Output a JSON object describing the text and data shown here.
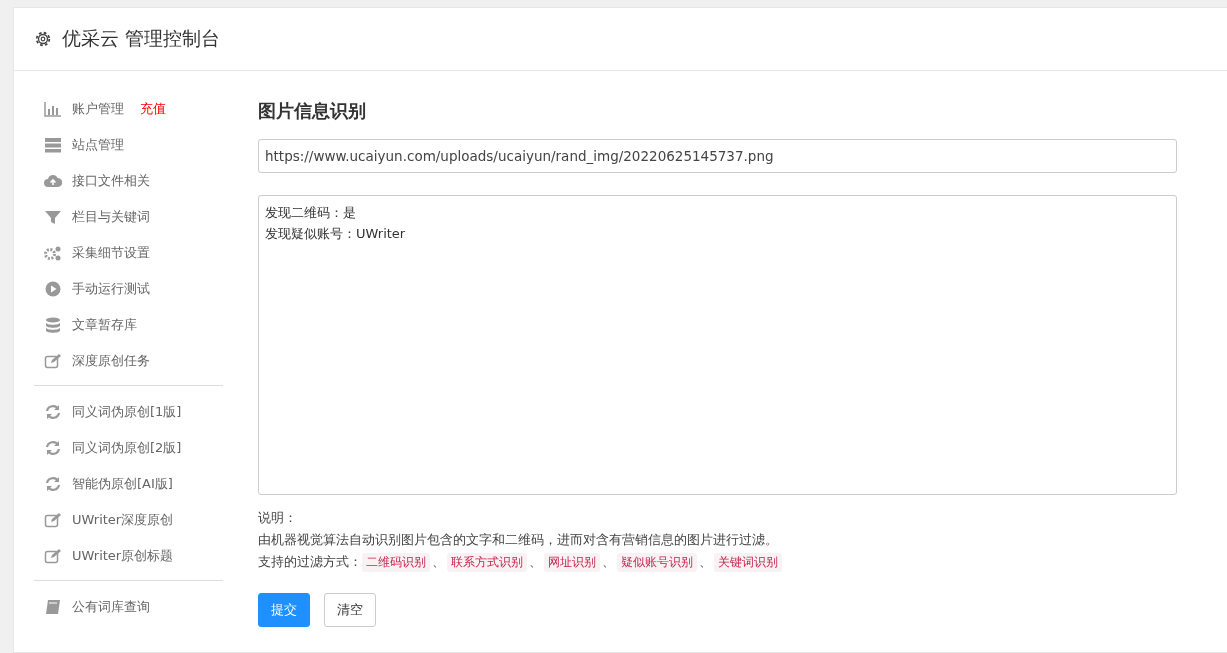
{
  "header": {
    "title": "优采云 管理控制台"
  },
  "sidebar": {
    "groups": [
      {
        "items": [
          {
            "label": "账户管理",
            "badge": "充值"
          },
          {
            "label": "站点管理"
          },
          {
            "label": "接口文件相关"
          },
          {
            "label": "栏目与关键词"
          },
          {
            "label": "采集细节设置"
          },
          {
            "label": "手动运行测试"
          },
          {
            "label": "文章暂存库"
          },
          {
            "label": "深度原创任务"
          }
        ]
      },
      {
        "items": [
          {
            "label": "同义词伪原创[1版]"
          },
          {
            "label": "同义词伪原创[2版]"
          },
          {
            "label": "智能伪原创[AI版]"
          },
          {
            "label": "UWriter深度原创"
          },
          {
            "label": "UWriter原创标题"
          }
        ]
      },
      {
        "items": [
          {
            "label": "公有词库查询"
          }
        ]
      }
    ]
  },
  "main": {
    "title": "图片信息识别",
    "url_field": {
      "value": "https://www.ucaiyun.com/uploads/ucaiyun/rand_img/20220625145737.png"
    },
    "result_box": {
      "lines": [
        "发现二维码：是",
        "发现疑似账号：UWriter"
      ]
    },
    "notes_heading": "说明：",
    "description": "由机器视觉算法自动识别图片包含的文字和二维码，进而对含有营销信息的图片进行过滤。",
    "filters_label": "支持的过滤方式：",
    "filters": [
      "二维码识别",
      "联系方式识别",
      "网址识别",
      "疑似账号识别",
      "关键词识别"
    ],
    "separator": "、",
    "buttons": [
      {
        "label": "提交",
        "kind": "primary"
      },
      {
        "label": "清空",
        "kind": "default"
      }
    ]
  }
}
